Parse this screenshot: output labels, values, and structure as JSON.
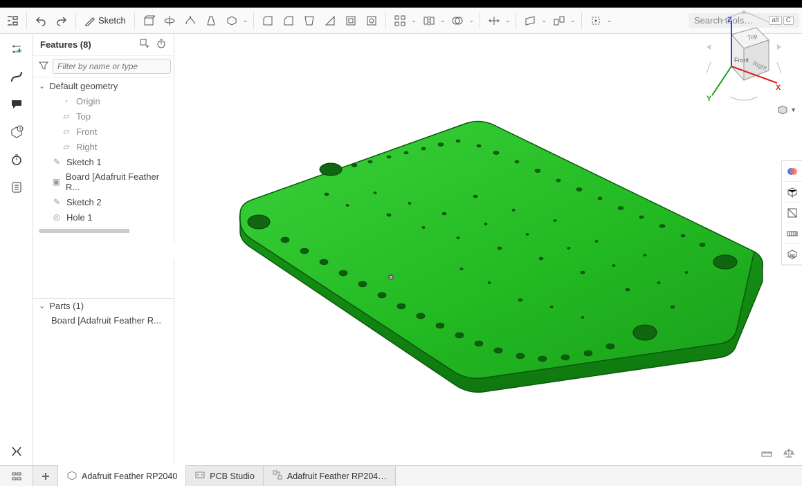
{
  "toolbar": {
    "sketch_label": "Sketch",
    "search_placeholder": "Search tools…",
    "kbd1": "alt",
    "kbd2": "C"
  },
  "features": {
    "title": "Features (8)",
    "filter_placeholder": "Filter by name or type",
    "default_geometry": "Default geometry",
    "origin": "Origin",
    "planes": {
      "top": "Top",
      "front": "Front",
      "right": "Right"
    },
    "items": {
      "sketch1": "Sketch 1",
      "board": "Board [Adafruit Feather R...",
      "sketch2": "Sketch 2",
      "hole1": "Hole 1"
    }
  },
  "parts": {
    "title": "Parts (1)",
    "item": "Board [Adafruit Feather R..."
  },
  "viewcube": {
    "top": "Top",
    "front": "Front",
    "right": "Right",
    "x": "X",
    "y": "Y",
    "z": "Z"
  },
  "tabs": {
    "t1": "Adafruit Feather RP2040",
    "t2": "PCB Studio",
    "t3": "Adafruit Feather RP204…"
  }
}
